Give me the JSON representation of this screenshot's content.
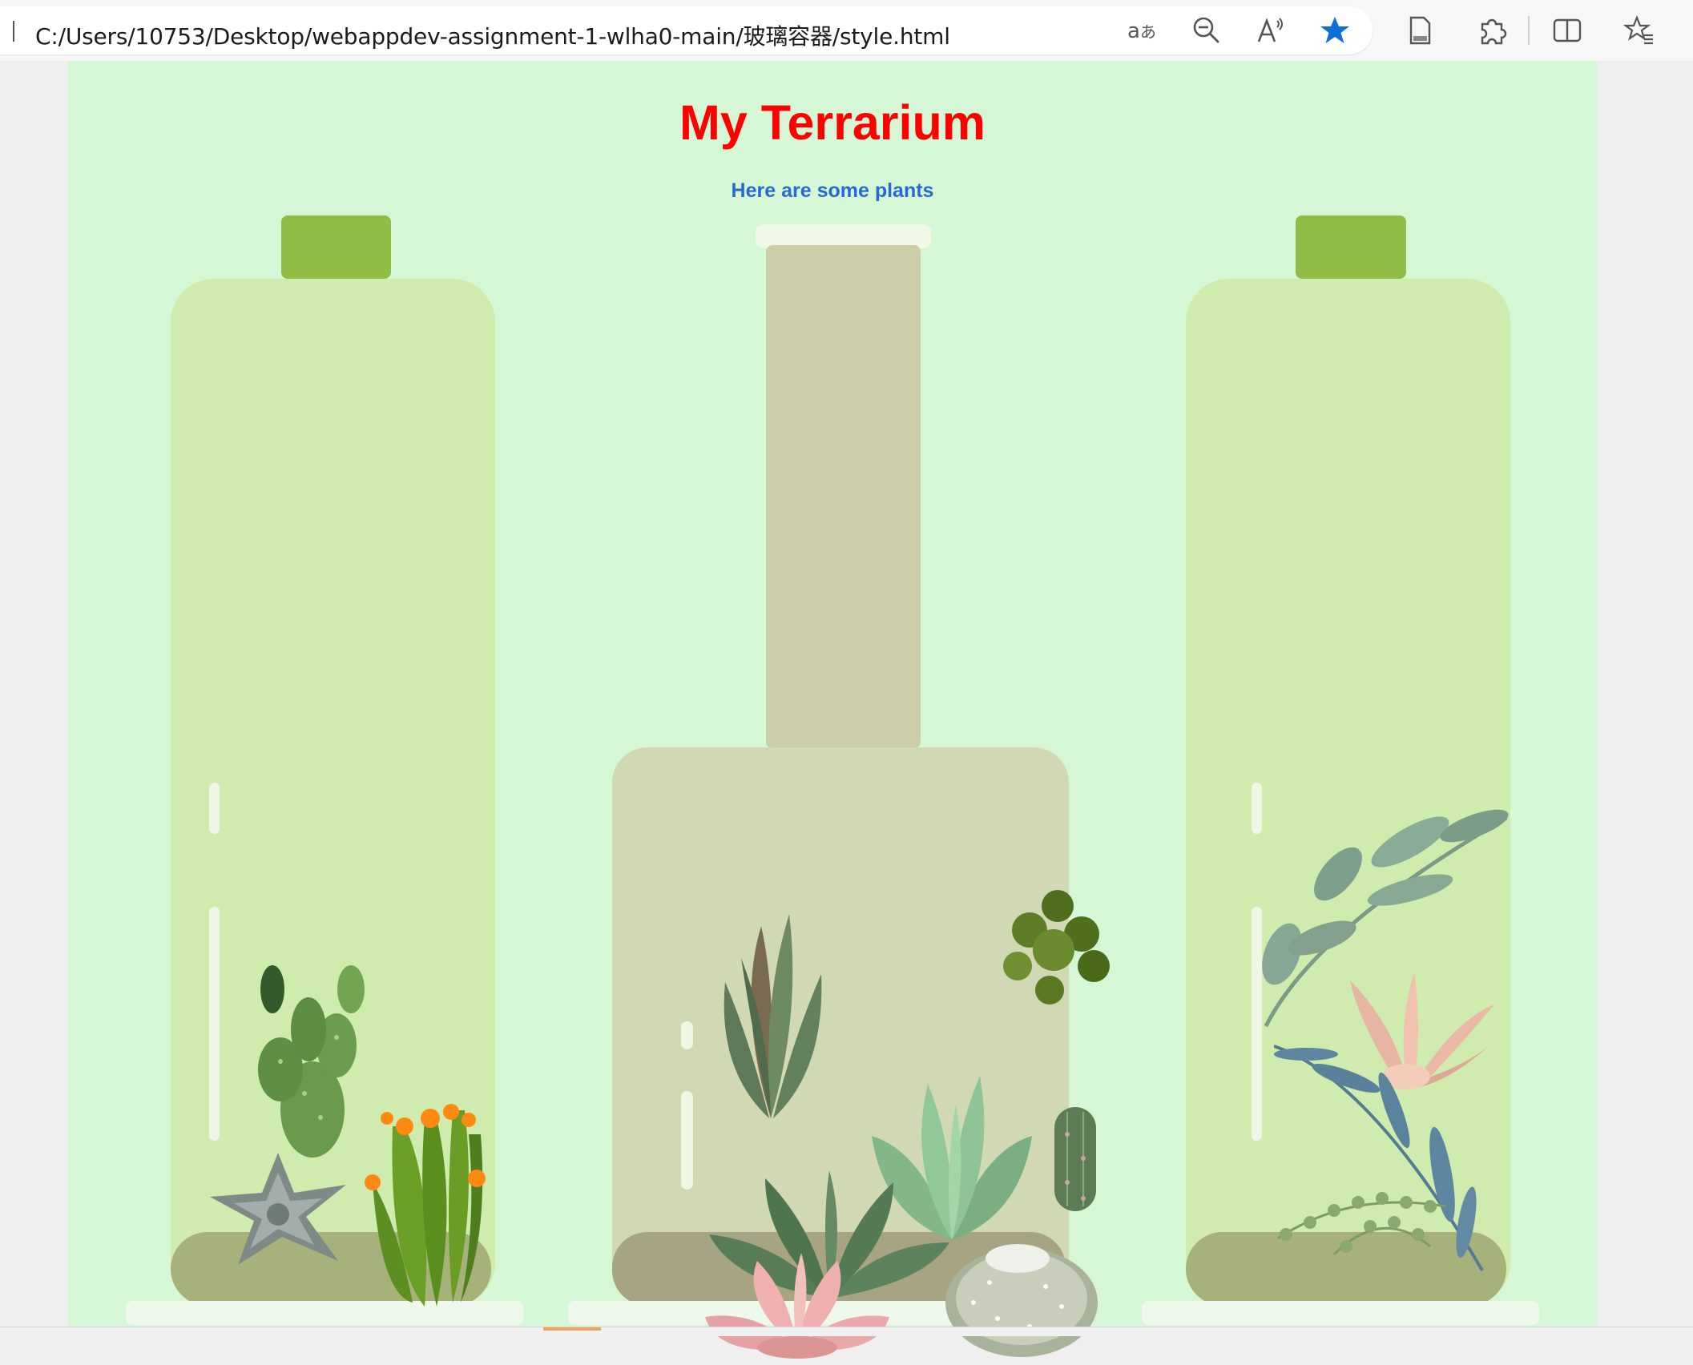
{
  "browser": {
    "url": "C:/Users/10753/Desktop/webappdev-assignment-1-wlha0-main/玻璃容器/style.html",
    "icons": [
      "translate-icon",
      "zoom-out-icon",
      "read-aloud-icon",
      "favorite-star-icon",
      "page-icon",
      "extensions-icon",
      "split-screen-icon",
      "favorites-icon"
    ],
    "accent_color": "#0c6fd6"
  },
  "page": {
    "title": "My Terrarium",
    "subtitle": "Here are some plants",
    "background_color": "#d5f7d5",
    "title_color": "#ff0000",
    "subtitle_color": "#2769d4"
  },
  "jars": [
    {
      "name": "left-jar",
      "plants": [
        "prickly-pear-cactus",
        "grey-echeveria",
        "orange-flowering-cactus"
      ]
    },
    {
      "name": "center-jar",
      "plants": [
        "aloe-succulent",
        "green-sedum",
        "mint-echeveria",
        "columnar-cactus",
        "green-rosette",
        "pink-echeveria",
        "white-ball-cactus"
      ]
    },
    {
      "name": "right-jar",
      "plants": [
        "eucalyptus-branch",
        "pink-air-plant",
        "blue-leaf-stem",
        "string-of-pearls"
      ]
    }
  ]
}
